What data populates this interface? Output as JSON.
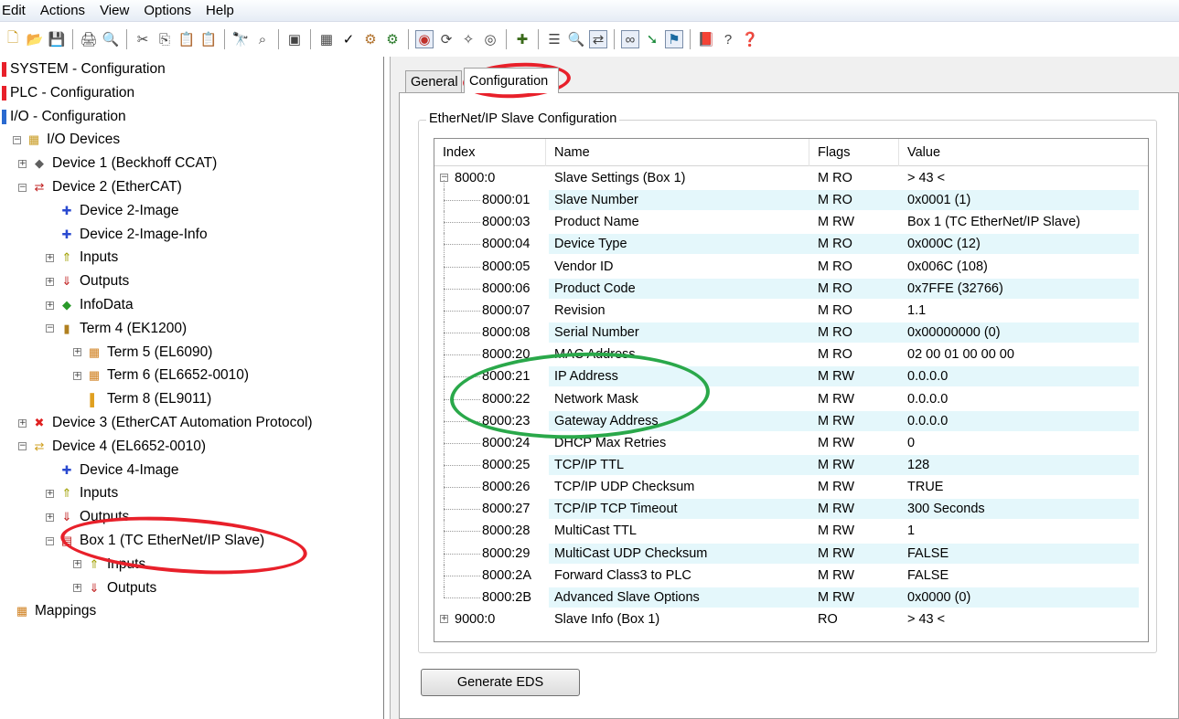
{
  "menu": [
    "Edit",
    "Actions",
    "View",
    "Options",
    "Help"
  ],
  "toolbar": {
    "icons": [
      "new-icon",
      "open-icon",
      "save-icon",
      "sep",
      "print-icon",
      "print-preview-icon",
      "sep",
      "cut-icon",
      "copy-icon",
      "paste-icon",
      "paste-special-icon",
      "sep",
      "find-icon",
      "zoom-icon",
      "sep",
      "target-icon",
      "sep",
      "activate-icon",
      "check-icon",
      "build-icon",
      "rebuild-icon",
      "sep",
      "config-mode-icon",
      "restart-icon",
      "scan-icon",
      "free-run-icon",
      "sep",
      "add-icon",
      "sep",
      "list-icon",
      "search-icon",
      "variables-icon",
      "sep",
      "watch-icon",
      "connect-icon",
      "online-icon",
      "sep",
      "book-icon",
      "help-icon",
      "question-icon"
    ]
  },
  "tree": {
    "items": [
      {
        "label": "SYSTEM - Configuration",
        "icon": "system-config-icon"
      },
      {
        "label": "PLC - Configuration",
        "icon": "plc-config-icon"
      },
      {
        "label": "I/O - Configuration",
        "icon": "io-config-icon"
      },
      {
        "label": "I/O Devices",
        "icon": "io-devices-icon"
      },
      {
        "label": "Device 1 (Beckhoff CCAT)",
        "icon": "device-card-icon"
      },
      {
        "label": "Device 2 (EtherCAT)",
        "icon": "ethercat-device-icon"
      },
      {
        "label": "Device 2-Image",
        "icon": "image-icon"
      },
      {
        "label": "Device 2-Image-Info",
        "icon": "image-icon"
      },
      {
        "label": "Inputs",
        "icon": "inputs-icon"
      },
      {
        "label": "Outputs",
        "icon": "outputs-icon"
      },
      {
        "label": "InfoData",
        "icon": "infodata-icon"
      },
      {
        "label": "Term 4 (EK1200)",
        "icon": "terminal-icon"
      },
      {
        "label": "Term 5 (EL6090)",
        "icon": "terminal-module-icon"
      },
      {
        "label": "Term 6 (EL6652-0010)",
        "icon": "terminal-module-icon"
      },
      {
        "label": "Term 8 (EL9011)",
        "icon": "end-terminal-icon"
      },
      {
        "label": "Device 3 (EtherCAT Automation Protocol)",
        "icon": "device-disabled-icon"
      },
      {
        "label": "Device 4 (EL6652-0010)",
        "icon": "device-slave-icon"
      },
      {
        "label": "Device 4-Image",
        "icon": "image-icon"
      },
      {
        "label": "Inputs",
        "icon": "inputs-icon"
      },
      {
        "label": "Outputs",
        "icon": "outputs-icon"
      },
      {
        "label": "Box 1 (TC EtherNet/IP Slave)",
        "icon": "box-icon"
      },
      {
        "label": "Inputs",
        "icon": "inputs-icon"
      },
      {
        "label": "Outputs",
        "icon": "outputs-icon"
      },
      {
        "label": "Mappings",
        "icon": "mappings-icon"
      }
    ]
  },
  "tabs": {
    "general": "General",
    "configuration": "Configuration"
  },
  "group_title": "EtherNet/IP Slave Configuration",
  "table": {
    "headers": [
      "Index",
      "Name",
      "Flags",
      "Value"
    ],
    "rows": [
      {
        "index": "8000:0",
        "name": "Slave Settings (Box 1)",
        "flags": "M RO",
        "value": "> 43 <"
      },
      {
        "index": "8000:01",
        "name": "Slave Number",
        "flags": "M RO",
        "value": "0x0001 (1)"
      },
      {
        "index": "8000:03",
        "name": "Product Name",
        "flags": "M RW",
        "value": "Box 1 (TC EtherNet/IP Slave)"
      },
      {
        "index": "8000:04",
        "name": "Device Type",
        "flags": "M RO",
        "value": "0x000C (12)"
      },
      {
        "index": "8000:05",
        "name": "Vendor ID",
        "flags": "M RO",
        "value": "0x006C (108)"
      },
      {
        "index": "8000:06",
        "name": "Product Code",
        "flags": "M RO",
        "value": "0x7FFE (32766)"
      },
      {
        "index": "8000:07",
        "name": "Revision",
        "flags": "M RO",
        "value": "1.1"
      },
      {
        "index": "8000:08",
        "name": "Serial Number",
        "flags": "M RO",
        "value": "0x00000000 (0)"
      },
      {
        "index": "8000:20",
        "name": "MAC Address",
        "flags": "M RO",
        "value": "02 00 01 00 00 00"
      },
      {
        "index": "8000:21",
        "name": "IP Address",
        "flags": "M RW",
        "value": "0.0.0.0"
      },
      {
        "index": "8000:22",
        "name": "Network Mask",
        "flags": "M RW",
        "value": "0.0.0.0"
      },
      {
        "index": "8000:23",
        "name": "Gateway Address",
        "flags": "M RW",
        "value": "0.0.0.0"
      },
      {
        "index": "8000:24",
        "name": "DHCP Max Retries",
        "flags": "M RW",
        "value": "0"
      },
      {
        "index": "8000:25",
        "name": "TCP/IP TTL",
        "flags": "M RW",
        "value": "128"
      },
      {
        "index": "8000:26",
        "name": "TCP/IP UDP Checksum",
        "flags": "M RW",
        "value": "TRUE"
      },
      {
        "index": "8000:27",
        "name": "TCP/IP TCP Timeout",
        "flags": "M RW",
        "value": "300 Seconds"
      },
      {
        "index": "8000:28",
        "name": "MultiCast TTL",
        "flags": "M RW",
        "value": "1"
      },
      {
        "index": "8000:29",
        "name": "MultiCast UDP Checksum",
        "flags": "M RW",
        "value": "FALSE"
      },
      {
        "index": "8000:2A",
        "name": "Forward Class3 to PLC",
        "flags": "M RW",
        "value": "FALSE"
      },
      {
        "index": "8000:2B",
        "name": "Advanced Slave Options",
        "flags": "M RW",
        "value": "0x0000 (0)"
      },
      {
        "index": "9000:0",
        "name": "Slave Info (Box 1)",
        "flags": "RO",
        "value": "> 43 <"
      }
    ]
  },
  "generate_button": "Generate EDS",
  "colors": {
    "annotation_red": "#e8202a",
    "annotation_green": "#2aa84a",
    "row_band": "#e4f7fb"
  }
}
